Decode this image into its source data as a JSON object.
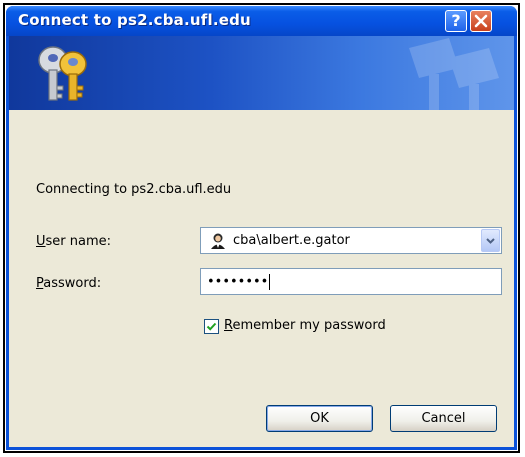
{
  "window": {
    "title": "Connect to ps2.cba.ufl.edu",
    "help_label": "?"
  },
  "dialog": {
    "connecting_text": "Connecting to ps2.cba.ufl.edu",
    "user_label_first": "U",
    "user_label_rest": "ser name:",
    "user_value": "cba\\albert.e.gator",
    "password_label_first": "P",
    "password_label_rest": "assword:",
    "password_value": "••••••••",
    "remember_first": "R",
    "remember_rest": "emember my password",
    "remember_checked": true,
    "ok_label": "OK",
    "cancel_label": "Cancel"
  },
  "icons": {
    "banner": "keys-icon",
    "user": "user-icon",
    "combo": "chevron-down-icon",
    "close": "close-icon",
    "help": "help-icon",
    "check": "check-icon"
  },
  "colors": {
    "titlebar": "#0651e0",
    "banner_dark": "#10389c",
    "banner_light": "#5f95ea",
    "dialog_bg": "#ece9d8"
  }
}
